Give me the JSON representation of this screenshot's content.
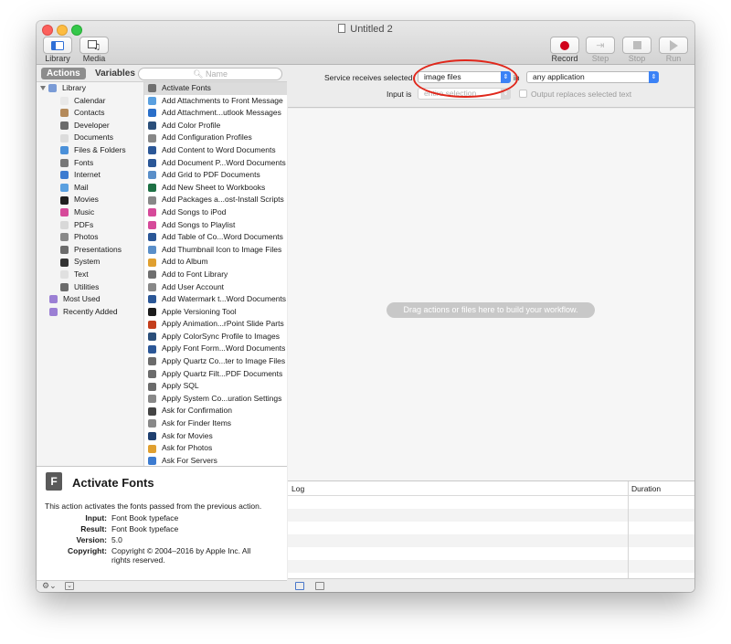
{
  "window": {
    "title": "Untitled 2",
    "colors": {
      "close": "#fc605c",
      "minimize": "#fdbc40",
      "zoom": "#34c84a",
      "accent": "#3b82f6",
      "annotation": "#e0271b"
    }
  },
  "toolbar": {
    "library_label": "Library",
    "media_label": "Media",
    "record_label": "Record",
    "step_label": "Step",
    "stop_label": "Stop",
    "run_label": "Run"
  },
  "library_panel": {
    "tabs": {
      "actions": "Actions",
      "variables": "Variables"
    },
    "search_placeholder": "Name",
    "root": "Library",
    "categories": [
      {
        "label": "Calendar",
        "icon": "calendar-icon",
        "color": "#e8e8e8"
      },
      {
        "label": "Contacts",
        "icon": "contacts-icon",
        "color": "#b48a5a"
      },
      {
        "label": "Developer",
        "icon": "tools-icon",
        "color": "#6b6b6b"
      },
      {
        "label": "Documents",
        "icon": "document-icon",
        "color": "#dcdcdc"
      },
      {
        "label": "Files & Folders",
        "icon": "finder-icon",
        "color": "#4a90d9"
      },
      {
        "label": "Fonts",
        "icon": "font-icon",
        "color": "#777777"
      },
      {
        "label": "Internet",
        "icon": "globe-icon",
        "color": "#3c7bd0"
      },
      {
        "label": "Mail",
        "icon": "mail-icon",
        "color": "#5aa0e0"
      },
      {
        "label": "Movies",
        "icon": "movie-icon",
        "color": "#1f1f1f"
      },
      {
        "label": "Music",
        "icon": "music-icon",
        "color": "#d64a9a"
      },
      {
        "label": "PDFs",
        "icon": "pdf-icon",
        "color": "#d8d8d8"
      },
      {
        "label": "Photos",
        "icon": "photo-icon",
        "color": "#888888"
      },
      {
        "label": "Presentations",
        "icon": "tools-icon",
        "color": "#6b6b6b"
      },
      {
        "label": "System",
        "icon": "system-icon",
        "color": "#333333"
      },
      {
        "label": "Text",
        "icon": "text-icon",
        "color": "#e0e0e0"
      },
      {
        "label": "Utilities",
        "icon": "tools-icon",
        "color": "#6b6b6b"
      }
    ],
    "smart_groups": [
      {
        "label": "Most Used",
        "icon": "smart-folder-icon",
        "color": "#9b7fd4"
      },
      {
        "label": "Recently Added",
        "icon": "smart-folder-icon",
        "color": "#9b7fd4"
      }
    ],
    "actions": [
      {
        "label": "Activate Fonts",
        "icon": "font-book-icon",
        "color": "#6f6f6f"
      },
      {
        "label": "Add Attachments to Front Message",
        "icon": "mail-icon",
        "color": "#5aa0e0"
      },
      {
        "label": "Add Attachment...utlook Messages",
        "icon": "outlook-icon",
        "color": "#2a6fc9"
      },
      {
        "label": "Add Color Profile",
        "icon": "colorsync-icon",
        "color": "#2b4f7a"
      },
      {
        "label": "Add Configuration Profiles",
        "icon": "automator-icon",
        "color": "#888888"
      },
      {
        "label": "Add Content to Word Documents",
        "icon": "word-icon",
        "color": "#2b5797"
      },
      {
        "label": "Add Document P...Word Documents",
        "icon": "word-icon",
        "color": "#2b5797"
      },
      {
        "label": "Add Grid to PDF Documents",
        "icon": "preview-icon",
        "color": "#5a8fc9"
      },
      {
        "label": "Add New Sheet to Workbooks",
        "icon": "excel-icon",
        "color": "#1e7145"
      },
      {
        "label": "Add Packages a...ost-Install Scripts",
        "icon": "automator-icon",
        "color": "#888888"
      },
      {
        "label": "Add Songs to iPod",
        "icon": "itunes-icon",
        "color": "#d64a9a"
      },
      {
        "label": "Add Songs to Playlist",
        "icon": "itunes-icon",
        "color": "#d64a9a"
      },
      {
        "label": "Add Table of Co...Word Documents",
        "icon": "word-icon",
        "color": "#2b5797"
      },
      {
        "label": "Add Thumbnail Icon to Image Files",
        "icon": "preview-icon",
        "color": "#5a8fc9"
      },
      {
        "label": "Add to Album",
        "icon": "photos-icon",
        "color": "#e0a030"
      },
      {
        "label": "Add to Font Library",
        "icon": "font-book-icon",
        "color": "#6f6f6f"
      },
      {
        "label": "Add User Account",
        "icon": "automator-icon",
        "color": "#888888"
      },
      {
        "label": "Add Watermark t...Word Documents",
        "icon": "word-icon",
        "color": "#2b5797"
      },
      {
        "label": "Apple Versioning Tool",
        "icon": "terminal-icon",
        "color": "#1c1c1c"
      },
      {
        "label": "Apply Animation...rPoint Slide Parts",
        "icon": "powerpoint-icon",
        "color": "#c43e1c"
      },
      {
        "label": "Apply ColorSync Profile to Images",
        "icon": "colorsync-icon",
        "color": "#2b4f7a"
      },
      {
        "label": "Apply Font Form...Word Documents",
        "icon": "word-icon",
        "color": "#2b5797"
      },
      {
        "label": "Apply Quartz Co...ter to Image Files",
        "icon": "tools-icon",
        "color": "#6b6b6b"
      },
      {
        "label": "Apply Quartz Filt...PDF Documents",
        "icon": "tools-icon",
        "color": "#6b6b6b"
      },
      {
        "label": "Apply SQL",
        "icon": "tools-icon",
        "color": "#6b6b6b"
      },
      {
        "label": "Apply System Co...uration Settings",
        "icon": "automator-icon",
        "color": "#888888"
      },
      {
        "label": "Ask for Confirmation",
        "icon": "automator-icon",
        "color": "#444444"
      },
      {
        "label": "Ask for Finder Items",
        "icon": "automator-icon",
        "color": "#888888"
      },
      {
        "label": "Ask for Movies",
        "icon": "quicktime-icon",
        "color": "#1f3f6f"
      },
      {
        "label": "Ask for Photos",
        "icon": "photos-icon",
        "color": "#e0a030"
      },
      {
        "label": "Ask For Servers",
        "icon": "globe-icon",
        "color": "#3c7bd0"
      }
    ]
  },
  "description": {
    "title": "Activate Fonts",
    "summary": "This action activates the fonts passed from the previous action.",
    "fields": [
      {
        "key": "Input:",
        "value": "Font Book typeface"
      },
      {
        "key": "Result:",
        "value": "Font Book typeface"
      },
      {
        "key": "Version:",
        "value": "5.0"
      },
      {
        "key": "Copyright:",
        "value": "Copyright © 2004–2016 by Apple Inc. All rights reserved."
      }
    ]
  },
  "service_bar": {
    "receives_label": "Service receives selected",
    "receives_value": "image files",
    "in_label": "in",
    "app_value": "any application",
    "input_is_label": "Input is",
    "input_is_value": "entire selection",
    "replace_label": "Output replaces selected text"
  },
  "workflow": {
    "hint": "Drag actions or files here to build your workflow."
  },
  "log": {
    "col_log": "Log",
    "col_duration": "Duration"
  },
  "bottom": {
    "gear_label": "⚙⌄"
  }
}
